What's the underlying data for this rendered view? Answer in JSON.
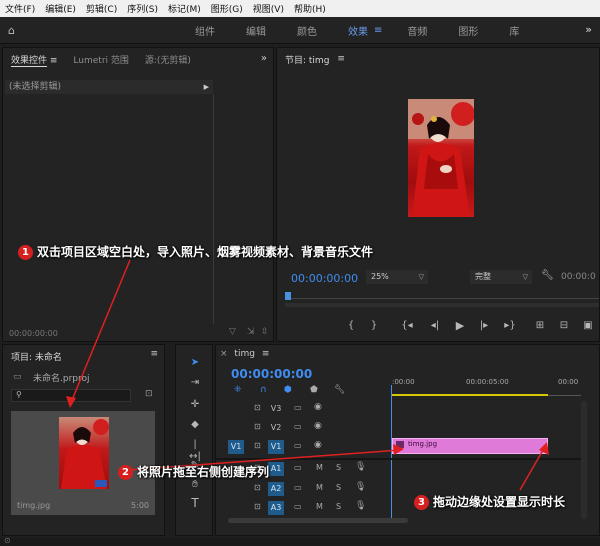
{
  "menu": [
    "文件(F)",
    "编辑(E)",
    "剪辑(C)",
    "序列(S)",
    "标记(M)",
    "图形(G)",
    "视图(V)",
    "帮助(H)"
  ],
  "workspace_tabs": [
    {
      "label": "组件",
      "active": false
    },
    {
      "label": "编辑",
      "active": false
    },
    {
      "label": "颜色",
      "active": false
    },
    {
      "label": "效果",
      "active": true
    },
    {
      "label": "音频",
      "active": false
    },
    {
      "label": "图形",
      "active": false
    },
    {
      "label": "库",
      "active": false
    }
  ],
  "effect_panel": {
    "tabs": [
      "效果控件",
      "Lumetri 范围",
      "源:(无剪辑)"
    ],
    "no_clip": "(未选择剪辑)",
    "timecode": "00:00:00:00"
  },
  "program_monitor": {
    "title": "节目: timg",
    "timecode": "00:00:00:00",
    "zoom": "25%",
    "quality": "完整"
  },
  "project_panel": {
    "title": "项目: 未命名",
    "file_name": "未命名.prproj",
    "thumb_name": "timg.jpg",
    "thumb_duration": "5:00"
  },
  "timeline": {
    "title": "timg",
    "timecode": "00:00:00:00",
    "ruler": [
      ":00:00",
      "00:00:05:00",
      "00:00"
    ],
    "video_tracks": [
      "V3",
      "V2",
      "V1"
    ],
    "audio_tracks": [
      "A1",
      "A2",
      "A3"
    ],
    "source_patch": "V1",
    "clip_name": "timg.jpg",
    "mute": "M",
    "solo": "S"
  },
  "annotations": [
    {
      "num": "1",
      "text": "双击项目区域空白处，导入照片、烟雾视频素材、背景音乐文件"
    },
    {
      "num": "2",
      "text": "将照片拖至右侧创建序列"
    },
    {
      "num": "3",
      "text": "拖动边缘处设置显示时长"
    }
  ],
  "colors": {
    "accent_blue": "#3f8df0",
    "clip_pink": "#e07ad8",
    "annotation_red": "#d62020",
    "playhead_blue": "#4a90e2"
  }
}
